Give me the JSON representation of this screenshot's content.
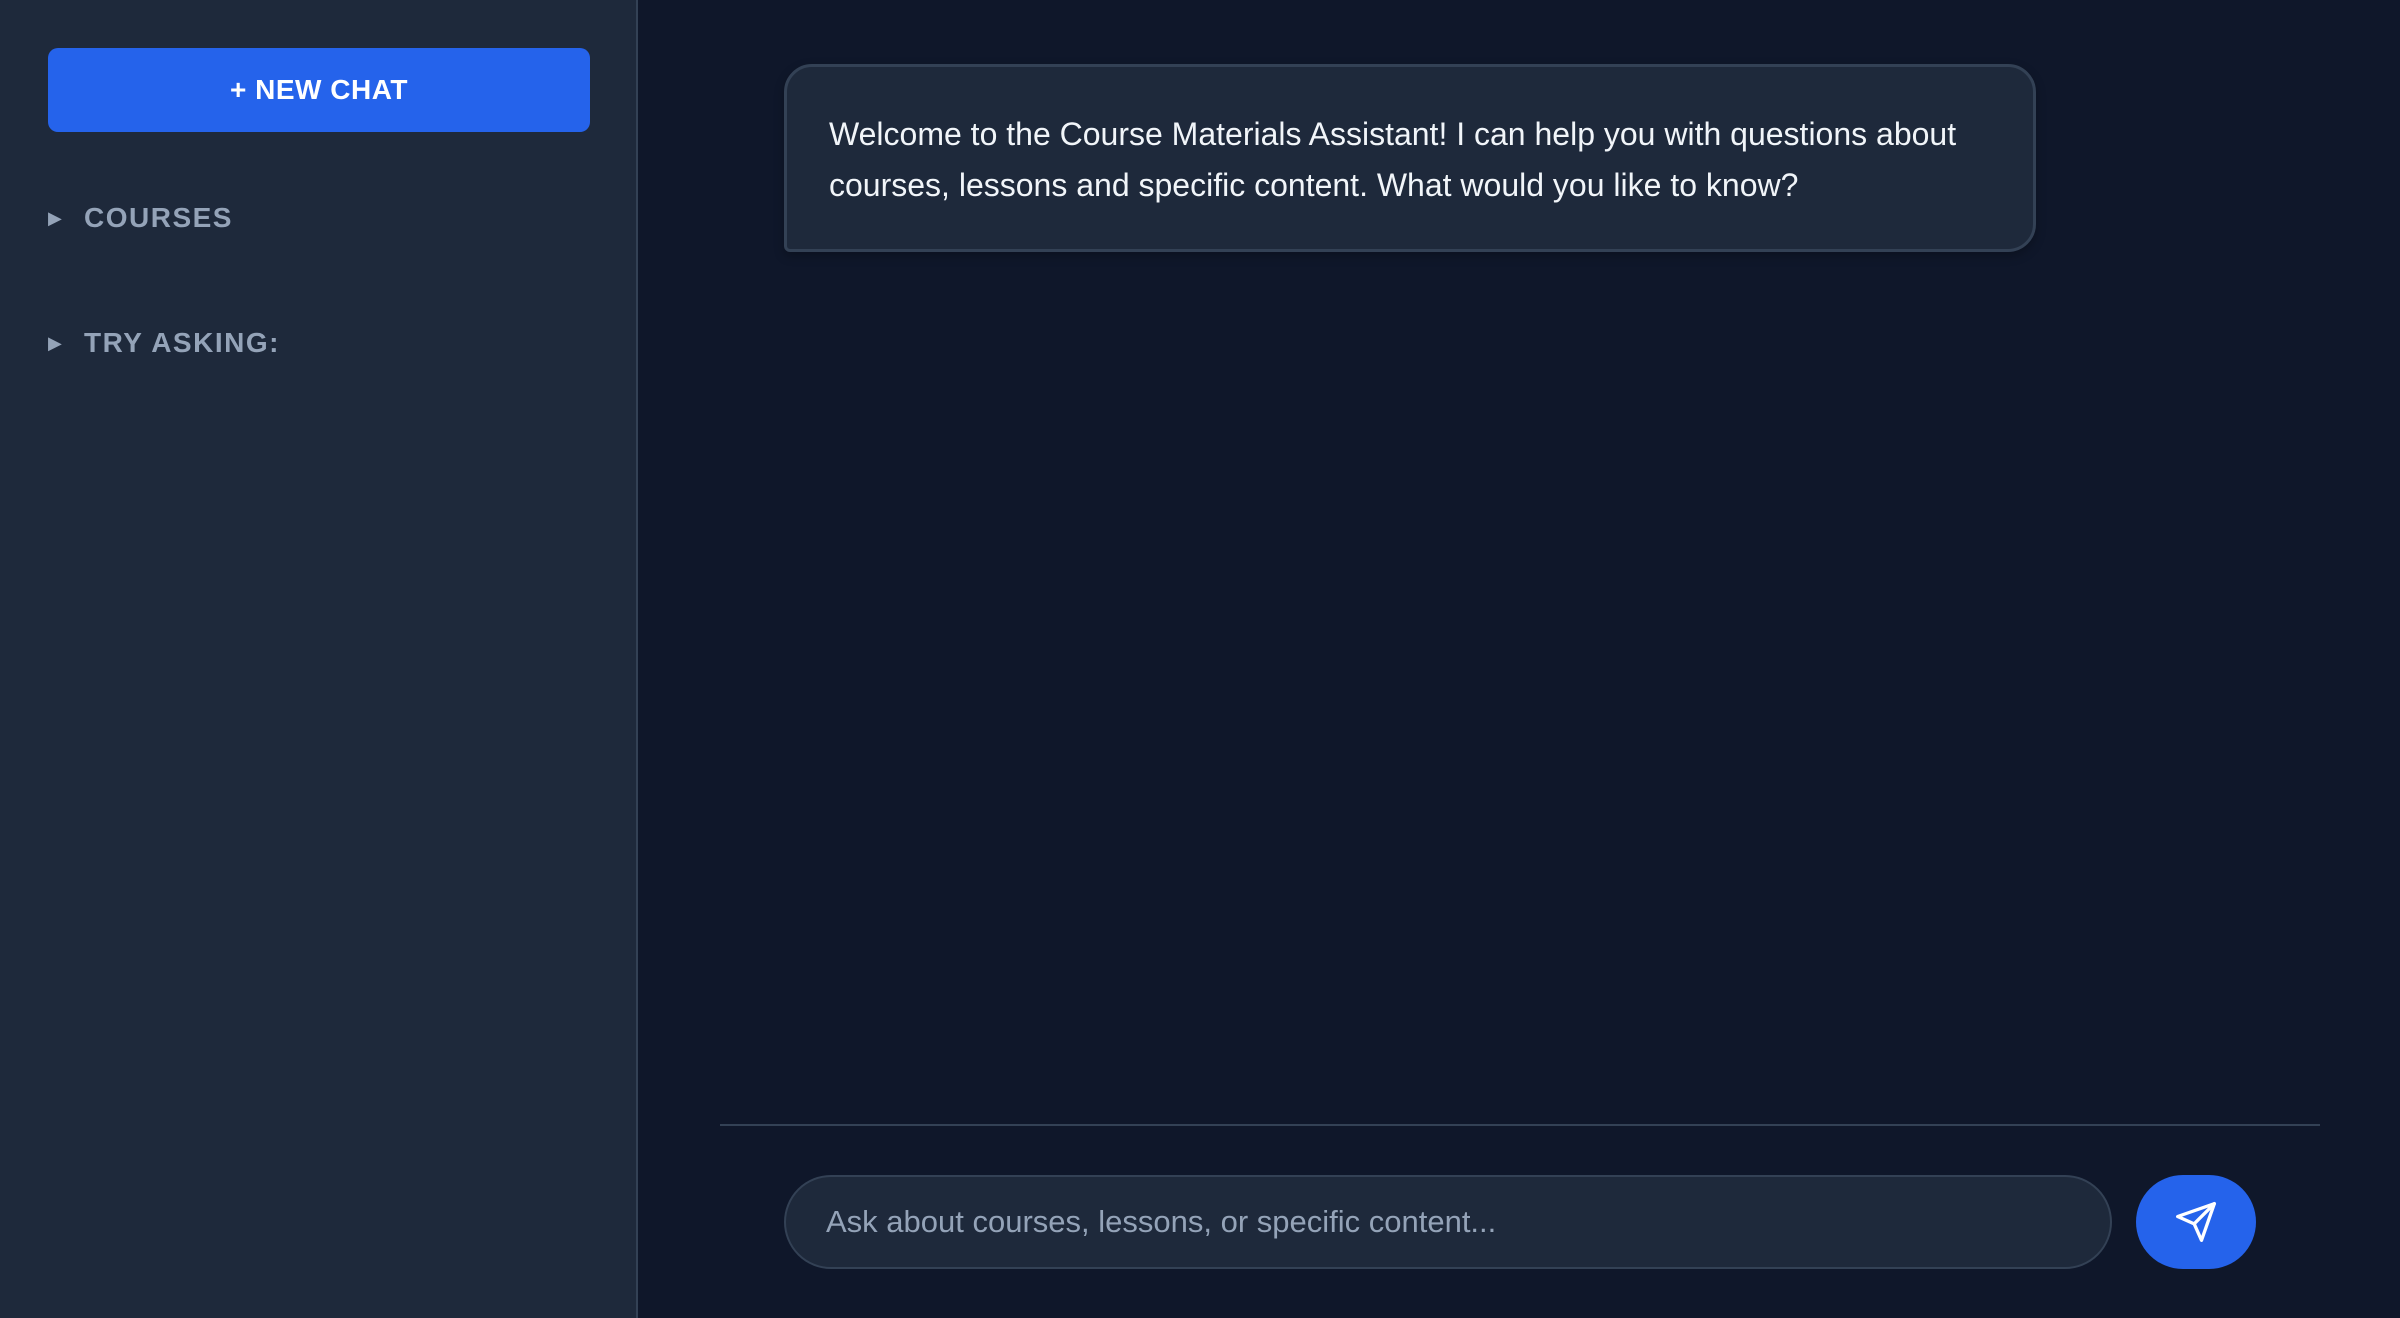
{
  "sidebar": {
    "new_chat_label": "+ NEW CHAT",
    "sections": [
      {
        "toggle_icon": "triangle-right-icon",
        "label": "COURSES"
      },
      {
        "toggle_icon": "triangle-right-icon",
        "label": "TRY ASKING:"
      }
    ]
  },
  "chat": {
    "messages": [
      {
        "role": "assistant",
        "text": "Welcome to the Course Materials Assistant! I can help you with questions about courses, lessons and specific content. What would you like to know?"
      }
    ],
    "input": {
      "value": "",
      "placeholder": "Ask about courses, lessons, or specific content..."
    },
    "send_icon": "send-icon"
  },
  "colors": {
    "accent": "#2563eb",
    "sidebar_bg": "#1e293b",
    "main_bg": "#0f172a",
    "border": "#334155",
    "muted_text": "#94a3b8",
    "text": "#f1f5f9"
  }
}
